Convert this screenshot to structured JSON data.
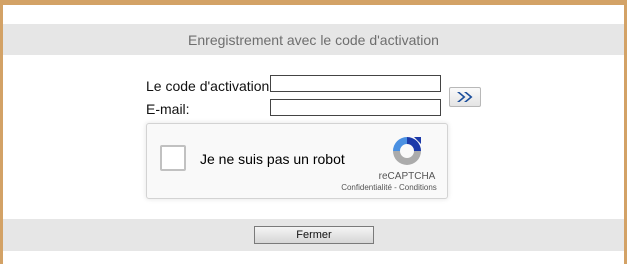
{
  "header": {
    "title": "Enregistrement avec le code d'activation"
  },
  "form": {
    "code_label": "Le code d'activation:",
    "code_value": "",
    "email_label": "E-mail:",
    "email_value": "",
    "submit_icon": "double-chevron-right-icon"
  },
  "recaptcha": {
    "label": "Je ne suis pas un robot",
    "brand": "reCAPTCHA",
    "privacy": "Confidentialité",
    "separator": " - ",
    "terms": "Conditions",
    "icon": "recaptcha-logo-icon"
  },
  "footer": {
    "close_label": "Fermer"
  },
  "colors": {
    "frame_border": "#d3a266",
    "bar_bg": "#e6e6e6",
    "submit_arrow": "#1c4f9c",
    "recaptcha_blue": "#1c3aa9",
    "recaptcha_lightblue": "#4a90e2",
    "recaptcha_gray": "#abababab"
  }
}
